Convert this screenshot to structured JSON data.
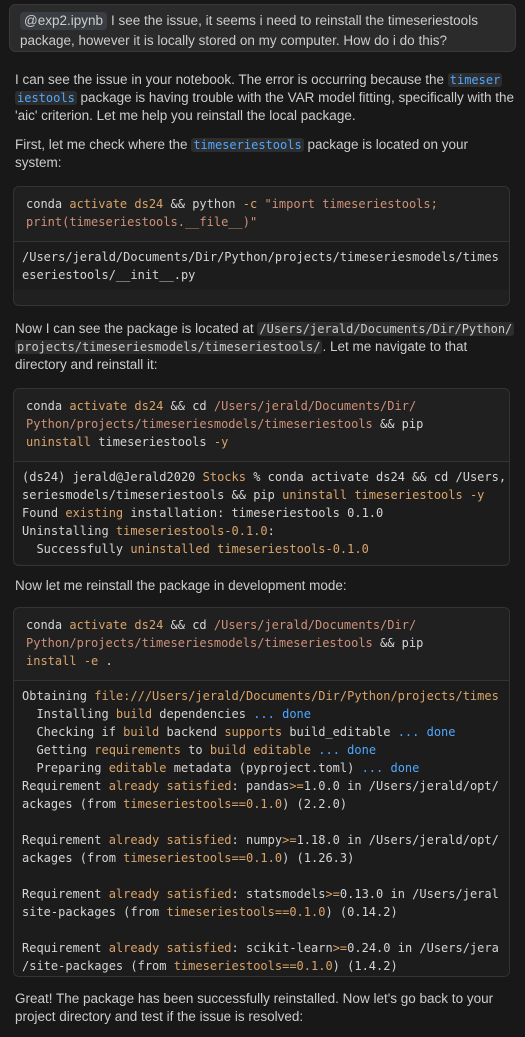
{
  "user_message": {
    "file_chip": "@exp2.ipynb",
    "text": "I see the issue, it seems i need to reinstall the timeseriestools package, however it is locally stored on my computer. How do i do this?"
  },
  "p1": {
    "a": "I can see the issue in your notebook. The error is occurring because the ",
    "code1": "timeser",
    "code2": "iestools",
    "b": " package is having trouble with the VAR model fitting, specifically with the 'aic' criterion. Let me help you reinstall the local package."
  },
  "p2": {
    "a": "First, let me check where the ",
    "code": "timeseriestools",
    "b": " package is located on your system:"
  },
  "block1": {
    "cmd": [
      [
        "conda",
        "activate ds24",
        " && ",
        "python",
        " -c ",
        "\"import timeseriestools;"
      ],
      [
        "print(timeseriestools.__file__)\""
      ]
    ],
    "out": [
      "/Users/jerald/Documents/Dir/Python/projects/timeseriesmodels/times",
      "eseriestools/__init__.py"
    ]
  },
  "p3": {
    "a": "Now I can see the package is located at ",
    "code1": "/Users/jerald/Documents/Dir/Python/",
    "code2": "projects/timeseriesmodels/timeseriestools/",
    "b": ". Let me navigate to that directory and reinstall it:"
  },
  "block2": {
    "cmd": [
      "conda activate ds24 && cd /Users/jerald/Documents/Dir/",
      "Python/projects/timeseriesmodels/timeseriestools && pip",
      "uninstall timeseriestools -y"
    ],
    "out": [
      "(ds24) jerald@Jerald2020 Stocks % conda activate ds24 && cd /Users,",
      "seriesmodels/timeseriestools && pip uninstall timeseriestools -y",
      "Found existing installation: timeseriestools 0.1.0",
      "Uninstalling timeseriestools-0.1.0:",
      "  Successfully uninstalled timeseriestools-0.1.0"
    ]
  },
  "p4": "Now let me reinstall the package in development mode:",
  "block3": {
    "cmd": [
      "conda activate ds24 && cd /Users/jerald/Documents/Dir/",
      "Python/projects/timeseriesmodels/timeseriestools && pip",
      "install -e ."
    ],
    "out": [
      "Obtaining file:///Users/jerald/Documents/Dir/Python/projects/times",
      "  Installing build dependencies ... done",
      "  Checking if build backend supports build_editable ... done",
      "  Getting requirements to build editable ... done",
      "  Preparing editable metadata (pyproject.toml) ... done",
      "Requirement already satisfied: pandas>=1.0.0 in /Users/jerald/opt/",
      "ackages (from timeseriestools==0.1.0) (2.2.0)",
      "",
      "Requirement already satisfied: numpy>=1.18.0 in /Users/jerald/opt/",
      "ackages (from timeseriestools==0.1.0) (1.26.3)",
      "",
      "Requirement already satisfied: statsmodels>=0.13.0 in /Users/jeral",
      "site-packages (from timeseriestools==0.1.0) (0.14.2)",
      "",
      "Requirement already satisfied: scikit-learn>=0.24.0 in /Users/jera",
      "/site-packages (from timeseriestools==0.1.0) (1.4.2)"
    ]
  },
  "p5": "Great! The package has been successfully reinstalled. Now let's go back to your project directory and test if the issue is resolved:"
}
